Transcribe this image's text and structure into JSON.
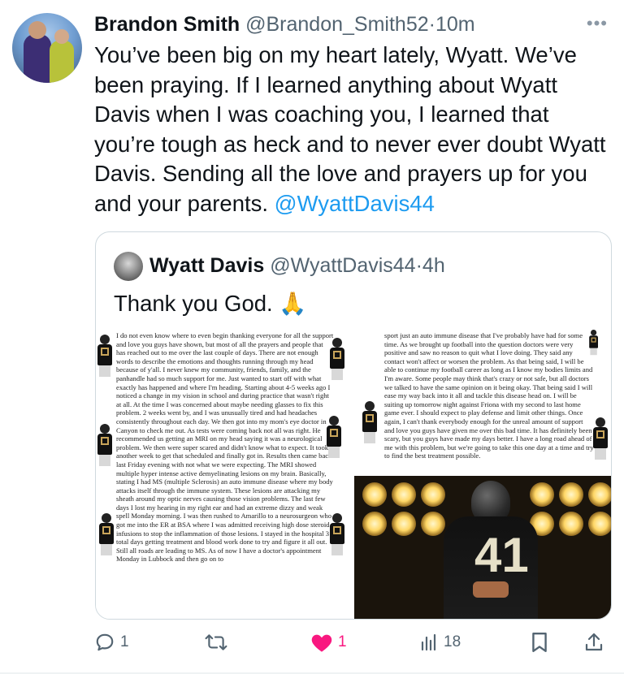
{
  "tweet": {
    "author_name": "Brandon Smith",
    "author_handle": "@Brandon_Smith52",
    "separator": "·",
    "time": "10m",
    "text": "You’ve been big on my heart lately, Wyatt. We’ve been praying. If I learned anything about Wyatt Davis when I was coaching you, I learned that you’re tough as heck and to never ever doubt Wyatt Davis. Sending all the love and prayers up for you and your parents. ",
    "mention": "@WyattDavis44",
    "more_icon": "more-horizontal-icon"
  },
  "quote": {
    "author_name": "Wyatt Davis",
    "author_handle": "@WyattDavis44",
    "separator": "·",
    "time": "4h",
    "text": "Thank you God. 🙏",
    "image": {
      "letter_left": "I do not even know where to even begin thanking everyone for all the support and love you guys have shown, but most of all the prayers and people that has reached out to me over the last couple of days. There are not enough words to describe the emotions and thoughts running through my head because of y'all. I never knew my community, friends, family, and the panhandle had so much support for me. Just wanted to start off with what exactly has happened and where I'm heading. Starting about 4-5 weeks ago I noticed a change in my vision in school and during practice that wasn't right at all. At the time I was concerned about maybe needing glasses to fix this problem. 2 weeks went by, and I was unusually tired and had headaches consistently throughout each day. We then got into my mom's eye doctor in Canyon to check me out. As tests were coming back not all was right. He recommended us getting an MRI on my head saying it was a neurological problem. We then were super scared and didn't know what to expect. It took another week to get that scheduled and finally got in. Results then came back last Friday evening with not what we were expecting. The MRI showed multiple hyper intense active demyelinating lesions on my brain. Basically, stating I had MS (multiple Sclerosis) an auto immune disease where my body attacks itself through the immune system. These lesions are attacking my sheath around my optic nerves causing those vision problems. The last few days I lost my hearing in my right ear and had an extreme dizzy and weak spell Monday morning. I was then rushed to Amarillo to a neurosurgeon who got me into the ER at BSA where I was admitted receiving high dose steroid infusions to stop the inflammation of those lesions. I stayed in the hospital 3 total days getting treatment and blood work done to try and figure it all out. Still all roads are leading to MS. As of now I have a doctor's appointment Monday in Lubbock and then go on to",
      "letter_right": "sport just an auto immune disease that I've probably have had for some time. As we brought up football into the question doctors were very positive and saw no reason to quit what I love doing. They said any contact won't affect or worsen the problem. As that being said, I will be able to continue my football career as long as I know my bodies limits and I'm aware. Some people may think that's crazy or not safe, but all doctors we talked to have the same opinion on it being okay. That being said I will ease my way back into it all and tackle this disease head on. I will be suiting up tomorrow night against Friona with my second to last home game ever. I should expect to play defense and limit other things. Once again, I can't thank everybody enough for the unreal amount of support and love you guys have given me over this bad time. It has definitely been scary, but you guys have made my days better. I have a long road ahead of me with this problem, but we're going to take this one day at a time and try to find the best treatment possible.",
      "jersey_number": "41"
    }
  },
  "actions": {
    "reply_icon": "reply-icon",
    "reply_count": "1",
    "retweet_icon": "retweet-icon",
    "like_icon": "heart-icon",
    "like_count": "1",
    "views_icon": "views-chart-icon",
    "views_count": "18",
    "bookmark_icon": "bookmark-icon",
    "share_icon": "share-icon"
  },
  "colors": {
    "text": "#0f1419",
    "secondary": "#536471",
    "link": "#1d9bf0",
    "like": "#f91880",
    "border": "#cfd9de"
  }
}
